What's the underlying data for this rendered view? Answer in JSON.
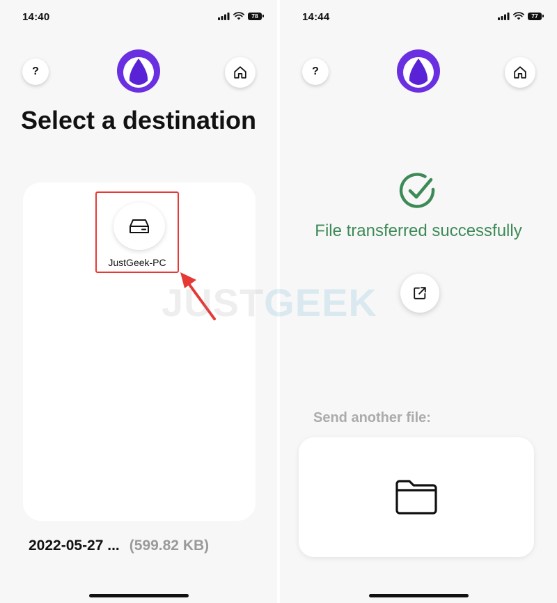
{
  "left": {
    "status": {
      "time": "14:40",
      "battery": "78"
    },
    "help_label": "?",
    "title": "Select a destination",
    "device": {
      "name": "JustGeek-PC"
    },
    "file": {
      "name": "2022-05-27 ...",
      "size": "(599.82 KB)"
    }
  },
  "right": {
    "status": {
      "time": "14:44",
      "battery": "77"
    },
    "help_label": "?",
    "success_message": "File transferred successfully",
    "send_another_label": "Send another file:"
  },
  "watermark": {
    "part1": "JUST",
    "part2": "GEEK"
  },
  "colors": {
    "logo_purple": "#6a2fe0",
    "success_green": "#3d8a57",
    "highlight_red": "#e53935",
    "muted_gray": "#9a9a9a"
  },
  "icons": {
    "help": "help-icon",
    "home": "home-icon",
    "logo": "app-logo",
    "device": "hard-drive-icon",
    "success": "check-circle-icon",
    "external": "external-link-icon",
    "folder": "folder-icon"
  }
}
